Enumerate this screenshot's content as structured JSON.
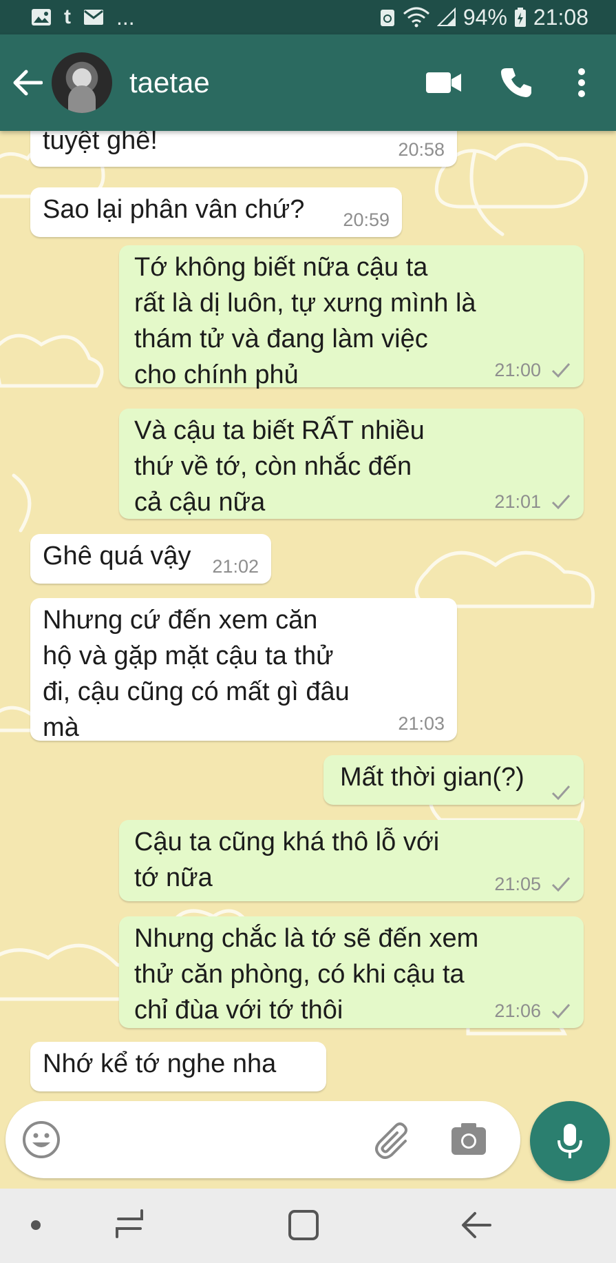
{
  "statusbar": {
    "left_icons": [
      "image-icon",
      "tumblr-icon",
      "mail-icon"
    ],
    "more": "...",
    "battery": "94%",
    "time": "21:08"
  },
  "header": {
    "contact_name": "taetae",
    "color": "#2b6a60"
  },
  "messages": [
    {
      "dir": "in",
      "text": "tuyệt ghê!",
      "time": "20:58"
    },
    {
      "dir": "in",
      "text": "Sao lại phân vân chứ?",
      "time": "20:59"
    },
    {
      "dir": "out",
      "text": "Tớ không biết nữa cậu ta\nrất là dị luôn, tự xưng mình là\nthám tử và đang làm việc\ncho chính phủ",
      "time": "21:00"
    },
    {
      "dir": "out",
      "text": "Và cậu ta biết RẤT nhiều\nthứ về tớ, còn nhắc đến\ncả cậu nữa",
      "time": "21:01"
    },
    {
      "dir": "in",
      "text": "Ghê quá vậy",
      "time": "21:02"
    },
    {
      "dir": "in",
      "text": "Nhưng cứ đến xem căn\nhộ và gặp mặt cậu ta thử\nđi, cậu cũng có mất gì đâu\nmà",
      "time": "21:03"
    },
    {
      "dir": "out",
      "text": "Mất thời gian(?)",
      "time": ""
    },
    {
      "dir": "out",
      "text": "Cậu ta cũng khá thô lỗ với\ntớ nữa",
      "time": "21:05"
    },
    {
      "dir": "out",
      "text": "Nhưng chắc là tớ sẽ đến xem\nthử căn phòng, có khi cậu ta\nchỉ đùa với tớ thôi",
      "time": "21:06"
    },
    {
      "dir": "in",
      "text": "Nhớ kể tớ nghe nha",
      "time": ""
    }
  ],
  "composer": {
    "placeholder": ""
  },
  "colors": {
    "incoming_bubble": "#ffffff",
    "outgoing_bubble": "#e4f9c9",
    "wallpaper": "#f4e7b0",
    "mic_button": "#2b7f6f"
  }
}
